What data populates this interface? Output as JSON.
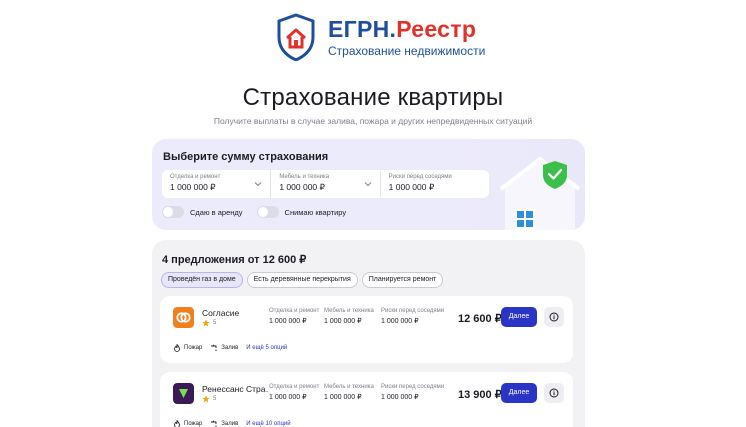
{
  "header": {
    "logo_part1": "ЕГРН.",
    "logo_part2": "Реестр",
    "logo_sub": "Страхование недвижимости",
    "brand_blue": "#1e4f9c",
    "brand_red": "#e0312b"
  },
  "page": {
    "title": "Страхование квартиры",
    "subtitle": "Получите выплаты в случае залива, пожара и других непредвиденных ситуаций"
  },
  "sum_card": {
    "title": "Выберите сумму страхования",
    "fields": [
      {
        "label": "Отделка и ремонт",
        "value": "1 000 000 ₽"
      },
      {
        "label": "Мебель и техника",
        "value": "1 000 000 ₽"
      },
      {
        "label": "Риски перед соседями",
        "value": "1 000 000 ₽"
      }
    ],
    "toggles": [
      {
        "label": "Сдаю в аренду",
        "on": false
      },
      {
        "label": "Снимаю квартиру",
        "on": false
      }
    ]
  },
  "offers": {
    "title": "4 предложения от 12 600 ₽",
    "chips": [
      {
        "label": "Проведён газ в доме",
        "active": true
      },
      {
        "label": "Есть деревянные перекрытия",
        "active": false
      },
      {
        "label": "Планируется ремонт",
        "active": false
      }
    ],
    "items": [
      {
        "name": "Согласие",
        "rating": "5",
        "logo_color": "#f07f1e",
        "coverage": [
          {
            "label": "Отделка и ремонт",
            "value": "1 000 000 ₽"
          },
          {
            "label": "Мебель и техника",
            "value": "1 000 000 ₽"
          },
          {
            "label": "Риски перед соседями",
            "value": "1 000 000 ₽"
          }
        ],
        "price": "12 600 ₽",
        "button": "Далее",
        "tags": [
          "Пожар",
          "Залив"
        ],
        "more": "И ещё 5 опций"
      },
      {
        "name": "Ренессанс Стра…",
        "rating": "5",
        "logo_color": "#3b1b57",
        "coverage": [
          {
            "label": "Отделка и ремонт",
            "value": "1 000 000 ₽"
          },
          {
            "label": "Мебель и техника",
            "value": "1 000 000 ₽"
          },
          {
            "label": "Риски перед соседями",
            "value": "1 000 000 ₽"
          }
        ],
        "price": "13 900 ₽",
        "button": "Далее",
        "tags": [
          "Пожар",
          "Залив"
        ],
        "more": "И ещё 10 опций"
      }
    ]
  },
  "colors": {
    "accent": "#2b35c5",
    "card_bg": "#ecebfb",
    "panel_bg": "#f2f2f5",
    "star": "#f2a516"
  }
}
